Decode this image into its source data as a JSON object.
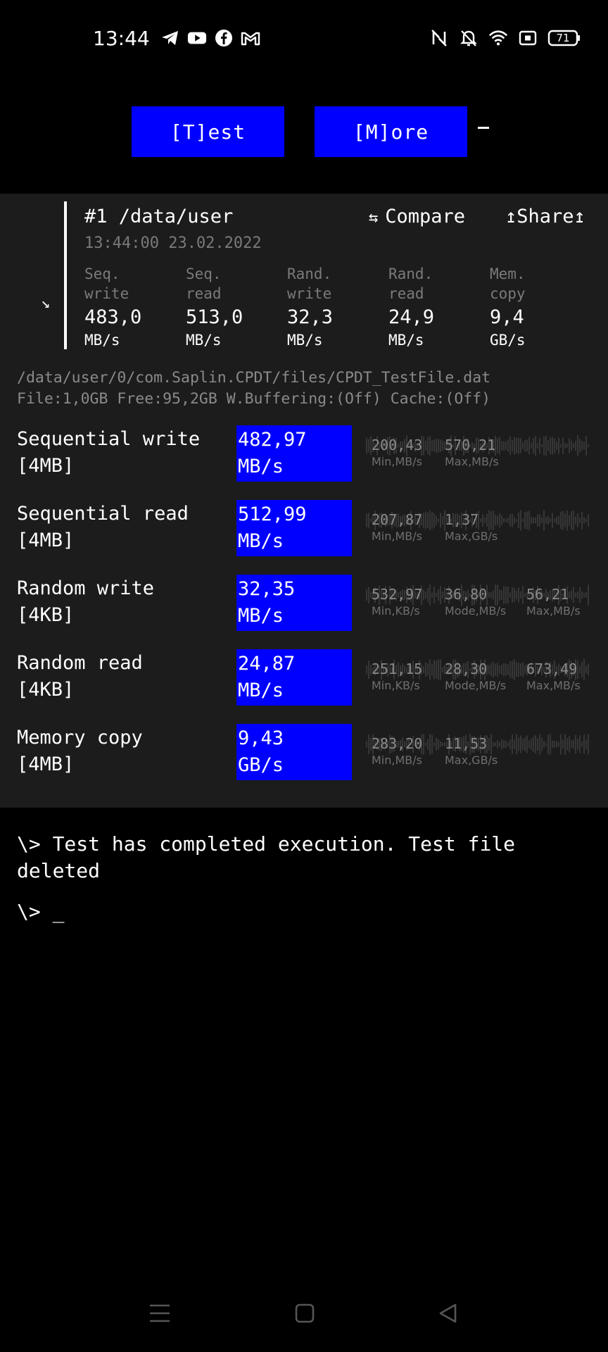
{
  "status_bar": {
    "time": "13:44",
    "battery": "71",
    "left_icons": [
      "telegram-icon",
      "youtube-icon",
      "facebook-icon",
      "gmail-icon"
    ],
    "right_icons": [
      "nfc-icon",
      "mute-icon",
      "wifi-icon",
      "screen-record-icon",
      "battery-icon"
    ]
  },
  "toolbar": {
    "test_label": "[T]est",
    "more_label": "[M]ore",
    "cursor": "_"
  },
  "result": {
    "title": "#1 /data/user",
    "compare_label": "Compare",
    "share_label": "Share",
    "timestamp": "13:44:00 23.02.2022",
    "summary": [
      {
        "label1": "Seq.",
        "label2": "write",
        "value": "483,0",
        "unit": "MB/s"
      },
      {
        "label1": "Seq.",
        "label2": "read",
        "value": "513,0",
        "unit": "MB/s"
      },
      {
        "label1": "Rand.",
        "label2": "write",
        "value": "32,3",
        "unit": "MB/s"
      },
      {
        "label1": "Rand.",
        "label2": "read",
        "value": "24,9",
        "unit": "MB/s"
      },
      {
        "label1": "Mem.",
        "label2": "copy",
        "value": "9,4",
        "unit": "GB/s"
      }
    ]
  },
  "file_info": {
    "path": "/data/user/0/com.Saplin.CPDT/files/CPDT_TestFile.dat",
    "details": "File:1,0GB Free:95,2GB W.Buffering:(Off) Cache:(Off)"
  },
  "tests": [
    {
      "name": "Sequential write",
      "block": "[4MB]",
      "value": "482,97",
      "unit": "MB/s",
      "stats": [
        {
          "value": "200,43",
          "label": "Min,MB/s"
        },
        {
          "value": "570,21",
          "label": "Max,MB/s"
        }
      ]
    },
    {
      "name": "Sequential read",
      "block": "[4MB]",
      "value": "512,99",
      "unit": "MB/s",
      "stats": [
        {
          "value": "207,87",
          "label": "Min,MB/s"
        },
        {
          "value": "1,37",
          "label": "Max,GB/s"
        }
      ]
    },
    {
      "name": "Random write",
      "block": "[4KB]",
      "value": "32,35",
      "unit": "MB/s",
      "stats": [
        {
          "value": "532,97",
          "label": "Min,KB/s"
        },
        {
          "value": "36,80",
          "label": "Mode,MB/s"
        },
        {
          "value": "56,21",
          "label": "Max,MB/s"
        }
      ]
    },
    {
      "name": "Random read",
      "block": "[4KB]",
      "value": "24,87",
      "unit": "MB/s",
      "stats": [
        {
          "value": "251,15",
          "label": "Min,KB/s"
        },
        {
          "value": "28,30",
          "label": "Mode,MB/s"
        },
        {
          "value": "673,49",
          "label": "Max,MB/s"
        }
      ]
    },
    {
      "name": "Memory copy",
      "block": "[4MB]",
      "value": "9,43",
      "unit": "GB/s",
      "stats": [
        {
          "value": "283,20",
          "label": "Min,MB/s"
        },
        {
          "value": "11,53",
          "label": "Max,GB/s"
        }
      ]
    }
  ],
  "console": {
    "message": "\\> Test has completed execution. Test file deleted",
    "prompt": "\\> _"
  },
  "colors": {
    "accent": "#0000ff",
    "background": "#000000",
    "panel": "#1c1c1c",
    "muted_text": "#8a8a8a"
  }
}
